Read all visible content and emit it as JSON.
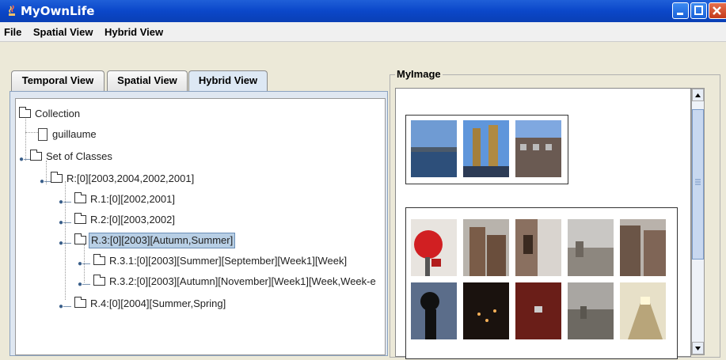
{
  "window": {
    "title": "MyOwnLife"
  },
  "menu": [
    "File",
    "Spatial View",
    "Hybrid View"
  ],
  "tabs": [
    {
      "label": "Temporal View"
    },
    {
      "label": "Spatial View"
    },
    {
      "label": "Hybrid View",
      "active": true
    }
  ],
  "tree": [
    {
      "label": "Collection",
      "icon": "folder-icon"
    },
    {
      "label": "guillaume",
      "icon": "file-icon"
    },
    {
      "label": "Set of Classes",
      "icon": "folder-icon"
    },
    {
      "label": "R:[0][2003,2004,2002,2001]",
      "icon": "folder-icon"
    },
    {
      "label": "R.1:[0][2002,2001]",
      "icon": "folder-icon"
    },
    {
      "label": "R.2:[0][2003,2002]",
      "icon": "folder-icon"
    },
    {
      "label": "R.3:[0][2003][Autumn,Summer]",
      "icon": "folder-icon",
      "selected": true
    },
    {
      "label": "R.3.1:[0][2003][Summer][September][Week1][Week]",
      "icon": "folder-icon"
    },
    {
      "label": "R.3.2:[0][2003][Autumn][November][Week1][Week,Week-e",
      "icon": "folder-icon"
    },
    {
      "label": "R.4:[0][2004][Summer,Spring]",
      "icon": "folder-icon"
    }
  ],
  "image_panel": {
    "title": "MyImage"
  },
  "colors": {
    "titlebar": "#0b47c9",
    "selection": "#b8cfe5",
    "tab_active": "#dde8f4"
  }
}
